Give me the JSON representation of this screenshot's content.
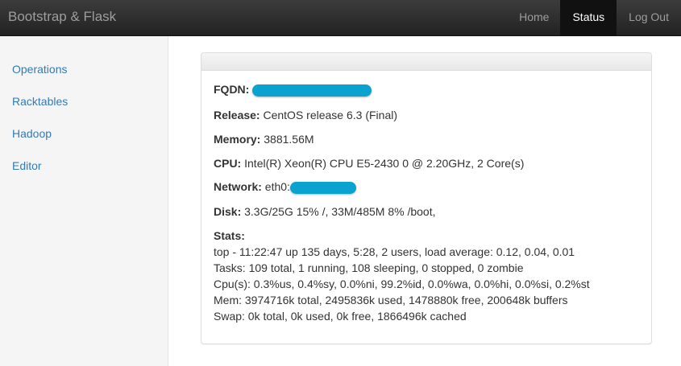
{
  "navbar": {
    "brand": "Bootstrap & Flask",
    "items": [
      {
        "label": "Home",
        "active": false
      },
      {
        "label": "Status",
        "active": true
      },
      {
        "label": "Log Out",
        "active": false
      }
    ]
  },
  "sidebar": {
    "items": [
      {
        "label": "Operations"
      },
      {
        "label": "Racktables"
      },
      {
        "label": "Hadoop"
      },
      {
        "label": "Editor"
      }
    ]
  },
  "status": {
    "fqdn": {
      "label": "FQDN:"
    },
    "release": {
      "label": "Release:",
      "value": "CentOS release 6.3 (Final)"
    },
    "memory": {
      "label": "Memory:",
      "value": "3881.56M"
    },
    "cpu": {
      "label": "CPU:",
      "value": "Intel(R) Xeon(R) CPU E5-2430 0 @ 2.20GHz, 2 Core(s)"
    },
    "network": {
      "label": "Network:",
      "value": "eth0:"
    },
    "disk": {
      "label": "Disk:",
      "value": "3.3G/25G 15% /, 33M/485M 8% /boot,"
    },
    "stats": {
      "label": "Stats:",
      "lines": [
        "top - 11:22:47 up 135 days, 5:28, 2 users, load average: 0.12, 0.04, 0.01",
        "Tasks: 109 total, 1 running, 108 sleeping, 0 stopped, 0 zombie",
        "Cpu(s): 0.3%us, 0.4%sy, 0.0%ni, 99.2%id, 0.0%wa, 0.0%hi, 0.0%si, 0.2%st",
        "Mem: 3974716k total, 2495836k used, 1478880k free, 200648k buffers",
        "Swap: 0k total, 0k used, 0k free, 1866496k cached"
      ]
    }
  },
  "colors": {
    "navbar": "#222222",
    "link": "#337ab7",
    "redaction": "#0aa3cf"
  }
}
